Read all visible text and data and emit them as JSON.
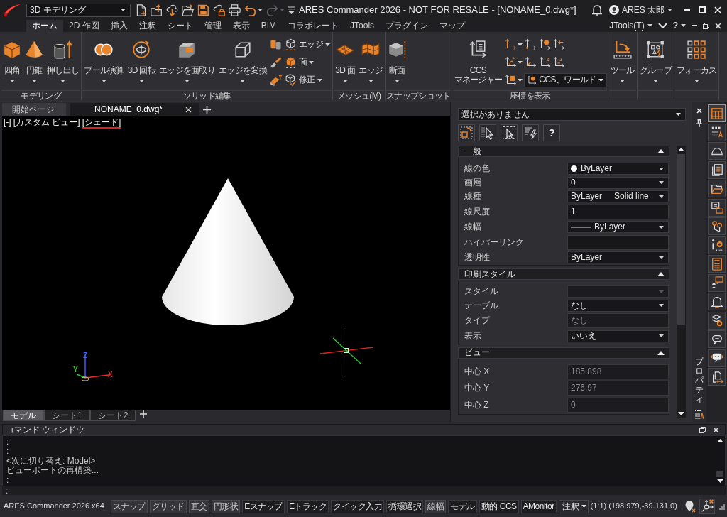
{
  "title_bar": {
    "workspace": "3D モデリング",
    "title": "ARES Commander 2026 - NOT FOR RESALE - [NONAME_0.dwg*]",
    "user": "ARES 太郎"
  },
  "quick_access": [
    {
      "dropdown": false,
      "disabled": false
    },
    {
      "dropdown": false,
      "disabled": false
    },
    {
      "dropdown": false,
      "disabled": false
    },
    {
      "dropdown": false,
      "disabled": false
    },
    {
      "dropdown": false,
      "disabled": false
    },
    {
      "dropdown": false,
      "disabled": false
    },
    {
      "dropdown": false,
      "disabled": false
    },
    {
      "dropdown": true,
      "disabled": false
    },
    {
      "dropdown": true,
      "disabled": true
    },
    {
      "dropdown": false,
      "disabled": false
    }
  ],
  "ribbon_tabs": [
    {
      "label": "ホーム",
      "selected": true
    },
    {
      "label": "2D 作図",
      "selected": false
    },
    {
      "label": "挿入",
      "selected": false
    },
    {
      "label": "注釈",
      "selected": false
    },
    {
      "label": "シート",
      "selected": false
    },
    {
      "label": "管理",
      "selected": false
    },
    {
      "label": "表示",
      "selected": false
    },
    {
      "label": "BIM",
      "selected": false
    },
    {
      "label": "コラボレート",
      "selected": false
    },
    {
      "label": "JTools",
      "selected": false
    },
    {
      "label": "プラグイン",
      "selected": false
    },
    {
      "label": "マップ",
      "selected": false
    }
  ],
  "ribbon_right": {
    "menu": "JTools(T)",
    "help": "?"
  },
  "ribbon_groups": [
    {
      "label": "モデリング",
      "items": [
        {
          "kind": "large",
          "label": "四角",
          "dropdown": true
        },
        {
          "kind": "large",
          "label": "円錐",
          "dropdown": true
        },
        {
          "kind": "large",
          "label": "押し出し",
          "dropdown": true
        }
      ]
    },
    {
      "label": "ソリッド編集",
      "items": [
        {
          "kind": "large",
          "label": "ブール演算",
          "dropdown": true
        },
        {
          "kind": "large",
          "label": "3D 回転",
          "dropdown": true
        },
        {
          "kind": "large",
          "label": "エッジを面取り",
          "dropdown": true
        },
        {
          "kind": "large",
          "label": "エッジを変換",
          "dropdown": true
        },
        {
          "kind": "grid",
          "rows": [
            [
              {
                "kind": "icon",
                "dropdown": false
              },
              {
                "kind": "small",
                "label": "エッジ",
                "dropdown": true
              }
            ],
            [
              {
                "kind": "icon",
                "dropdown": false
              },
              {
                "kind": "small",
                "label": "面",
                "dropdown": true
              }
            ],
            [
              {
                "kind": "icon",
                "dropdown": false
              },
              {
                "kind": "small",
                "label": "修正",
                "dropdown": true
              }
            ]
          ]
        }
      ]
    },
    {
      "label": "メッシュ(M)",
      "items": [
        {
          "kind": "large",
          "label": "3D 面",
          "dropdown": true
        },
        {
          "kind": "large",
          "label": "エッジ",
          "dropdown": true
        }
      ]
    },
    {
      "label": "スナップショット",
      "items": [
        {
          "kind": "large",
          "label": "断面",
          "dropdown": true
        }
      ]
    },
    {
      "label": "座標を表示",
      "items": [
        {
          "kind": "large",
          "label": "CCS マネージャー",
          "dropdown": false
        },
        {
          "kind": "grid",
          "rows": [
            [
              {
                "kind": "icon",
                "dropdown": true
              },
              {
                "kind": "icon",
                "dropdown": false
              },
              {
                "kind": "icon",
                "dropdown": false
              },
              {
                "kind": "icon",
                "dropdown": false
              }
            ],
            [
              {
                "kind": "icon",
                "dropdown": true
              },
              {
                "kind": "icon",
                "dropdown": false
              },
              {
                "kind": "icon",
                "dropdown": false
              },
              {
                "kind": "icon",
                "dropdown": false
              }
            ],
            [
              {
                "kind": "icon",
                "dropdown": true
              },
              {
                "kind": "combo",
                "label": "CCS、ワールド"
              }
            ]
          ]
        }
      ]
    },
    {
      "items": [
        {
          "kind": "large",
          "label": "ツール",
          "dropdown": true
        }
      ]
    },
    {
      "items": [
        {
          "kind": "large",
          "label": "グループ",
          "dropdown": true
        }
      ]
    },
    {
      "items": [
        {
          "kind": "large",
          "label": "フォーカス",
          "dropdown": true
        }
      ]
    }
  ],
  "document_tabs": [
    {
      "label": "開始ページ",
      "selected": false,
      "closable": false
    },
    {
      "label": "NONAME_0.dwg*",
      "selected": true,
      "closable": true
    }
  ],
  "viewport": {
    "view_controls": [
      {
        "label": "[-]",
        "underlined": false
      },
      {
        "label": "[カスタム ビュー]",
        "underlined": false
      },
      {
        "label": "[シェード]",
        "underlined": true
      }
    ],
    "axis_labels": [
      "Z",
      "Y",
      "X"
    ]
  },
  "layout_tabs": [
    {
      "label": "モデル",
      "selected": true
    },
    {
      "label": "シート1",
      "selected": false
    },
    {
      "label": "シート2",
      "selected": false
    }
  ],
  "properties": {
    "selection": "選択がありません",
    "help": "?",
    "palette_label": "プロパティ",
    "sections": [
      {
        "title": "一般",
        "expanded": true,
        "rows": [
          {
            "label": "線の色",
            "kind": "color",
            "value": "ByLayer",
            "color": "#ffffff",
            "disabled": false
          },
          {
            "label": "画層",
            "kind": "dropdown",
            "value": "0",
            "disabled": false
          },
          {
            "label": "線種",
            "kind": "dropdown",
            "value": "ByLayer",
            "detail": "Solid line",
            "disabled": false
          },
          {
            "label": "線尺度",
            "kind": "text",
            "value": "1",
            "disabled": false
          },
          {
            "label": "線幅",
            "kind": "lineweight",
            "value": "ByLayer",
            "disabled": false
          },
          {
            "label": "ハイパーリンク",
            "kind": "text",
            "disabled": false
          },
          {
            "label": "透明性",
            "kind": "dropdown",
            "value": "ByLayer",
            "disabled": false
          }
        ]
      },
      {
        "title": "印刷スタイル",
        "expanded": true,
        "rows": [
          {
            "label": "スタイル",
            "kind": "dropdown",
            "disabled": true
          },
          {
            "label": "テーブル",
            "kind": "dropdown",
            "value": "なし",
            "disabled": false
          },
          {
            "label": "タイプ",
            "kind": "text",
            "value": "なし",
            "disabled": true
          },
          {
            "label": "表示",
            "kind": "dropdown",
            "value": "いいえ",
            "disabled": false
          }
        ]
      },
      {
        "title": "ビュー",
        "expanded": true,
        "rows": [
          {
            "label": "中心 X",
            "kind": "text",
            "value": "185.898",
            "disabled": true
          },
          {
            "label": "中心 Y",
            "kind": "text",
            "value": "276.97",
            "disabled": true
          },
          {
            "label": "中心 Z",
            "kind": "text",
            "value": "0",
            "disabled": true
          }
        ]
      }
    ]
  },
  "side_tabs": [
    {
      "selected": true
    },
    {
      "selected": false
    },
    {
      "selected": false
    },
    {
      "selected": false
    },
    {
      "selected": false
    },
    {
      "selected": false
    },
    {
      "selected": false
    },
    {
      "selected": false
    },
    {
      "selected": false
    },
    {
      "selected": false
    },
    {
      "selected": false
    },
    {
      "selected": false
    },
    {
      "selected": false
    },
    {
      "selected": false
    },
    {
      "selected": false
    }
  ],
  "command_window": {
    "title": "コマンド ウィンドウ",
    "lines": [
      ":",
      ":",
      "<次に切り替え: Model>",
      "ビューポートの再構築...",
      ":"
    ],
    "prompt": ":"
  },
  "status_bar": {
    "product": "ARES Commander 2026 x64",
    "toggles": [
      {
        "label": "スナップ",
        "on": false
      },
      {
        "label": "グリッド",
        "on": false
      },
      {
        "label": "直交",
        "on": false
      },
      {
        "label": "円形状",
        "on": false
      },
      {
        "label": "Eスナップ",
        "on": true
      },
      {
        "label": "Eトラック",
        "on": true
      },
      {
        "label": "クイック入力",
        "on": true
      },
      {
        "label": "循環選択",
        "on": true
      },
      {
        "label": "線幅",
        "on": false
      },
      {
        "label": "モデル",
        "on": true
      },
      {
        "label": "動的 CCS",
        "on": true
      },
      {
        "label": "AMonitor",
        "on": true
      }
    ],
    "annotation": "注釈",
    "scale": "(1:1)",
    "coordinates": "(198.979,-39.131,0)"
  }
}
